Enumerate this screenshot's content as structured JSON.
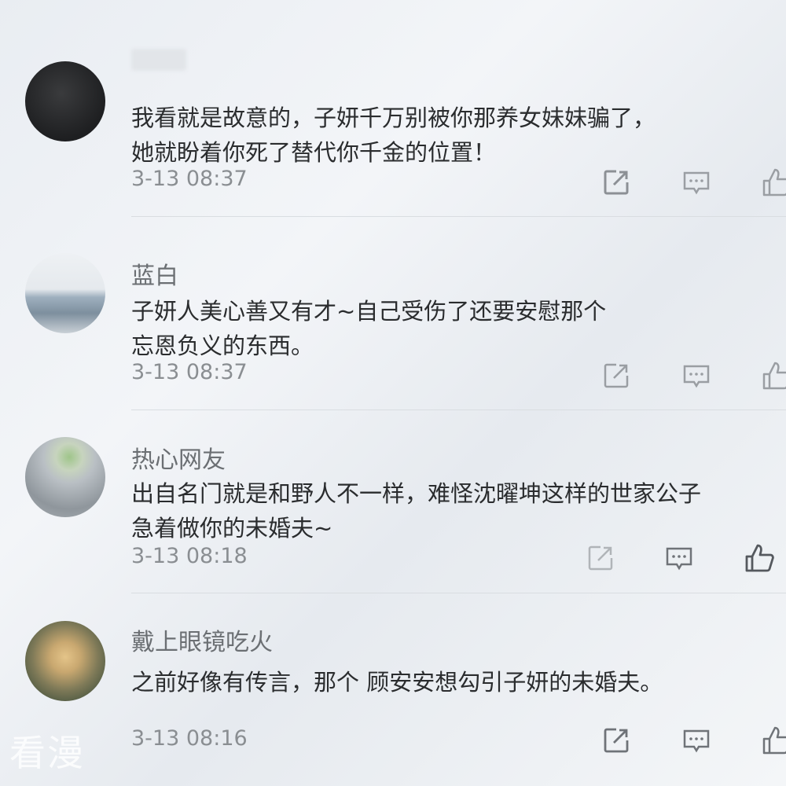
{
  "comments": [
    {
      "username": "",
      "content": "我看就是故意的，子妍千万别被你那养女妹妹骗了，\n她就盼着你死了替代你千金的位置！",
      "time": "3-13 08:37"
    },
    {
      "username": "蓝白",
      "content": "子妍人美心善又有才~自己受伤了还要安慰那个\n忘恩负义的东西。",
      "time": "3-13 08:37"
    },
    {
      "username": "热心网友",
      "content": "出自名门就是和野人不一样，难怪沈曜坤这样的世家公子\n急着做你的未婚夫~",
      "time": "3-13 08:18"
    },
    {
      "username": "戴上眼镜吃火",
      "content": "之前好像有传言，那个 顾安安想勾引子妍的未婚夫。",
      "time": "3-13 08:16"
    }
  ],
  "icons": {
    "share": "share-icon",
    "reply": "comment-icon",
    "like": "thumbs-up-icon"
  },
  "watermark": "看漫",
  "colors": {
    "text": "#2a2c2e",
    "meta": "#8a8e92",
    "icon": "#9a9ea3"
  }
}
